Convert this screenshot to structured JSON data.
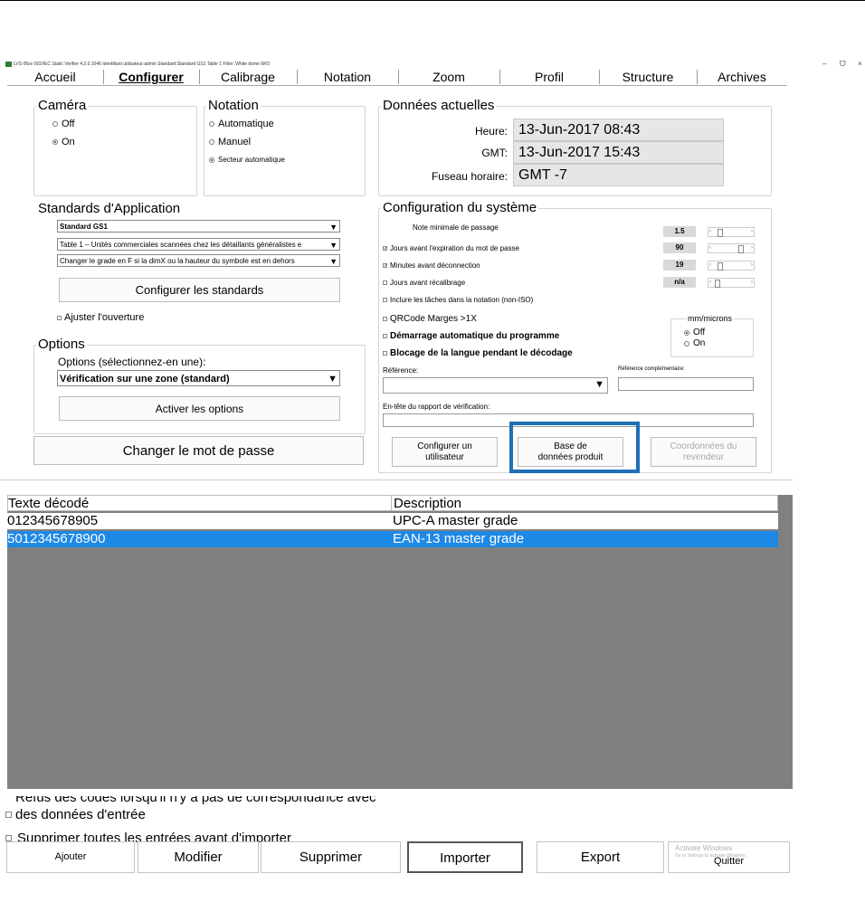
{
  "titlebar": {
    "text": "LVS-95xx ISO/IEC Static Verifier 4.2.0.1046   Identifiant utilisateur:admin   Standard:Standard GS1 Table 1   Filtre: White dome W/O",
    "minimize": "–",
    "maximize": "ᗜ",
    "close": "×"
  },
  "tabs": [
    "Accueil",
    "Configurer",
    "Calibrage",
    "Notation",
    "Zoom",
    "Profil",
    "Structure",
    "Archives"
  ],
  "camera": {
    "title": "Caméra",
    "options": [
      "Off",
      "On"
    ],
    "selected": "On"
  },
  "notation": {
    "title": "Notation",
    "options": [
      "Automatique",
      "Manuel",
      "Secteur automatique"
    ],
    "selected": "Secteur automatique"
  },
  "current_data": {
    "title": "Données actuelles",
    "heure_label": "Heure:",
    "heure_value": "13-Jun-2017 08:43",
    "gmt_label": "GMT:",
    "gmt_value": "13-Jun-2017 15:43",
    "tz_label": "Fuseau horaire:",
    "tz_value": "GMT -7"
  },
  "standards": {
    "title": "Standards d'Application",
    "dropdown1": "Standard GS1",
    "dropdown2": "Table 1 – Unités commerciales scannées chez les détaillants généralistes e",
    "dropdown3": "Changer le grade en F si la dimX ou la hauteur du symbole est en dehors",
    "configure_button": "Configurer les standards",
    "aperture_checkbox": "Ajuster l'ouverture"
  },
  "options": {
    "title": "Options",
    "label": "Options (sélectionnez-en une):",
    "dropdown": "Vérification sur une zone (standard)",
    "activate_button": "Activer les options"
  },
  "change_password_button": "Changer le mot de passe",
  "sysconfig": {
    "title": "Configuration du système",
    "min_grade_label": "Note minimale de passage",
    "min_grade_value": "1.5",
    "min_grade_level": 0.1,
    "pwd_expiry_label": "Jours avant l'expiration du mot de passe",
    "pwd_expiry_checked": true,
    "pwd_expiry_value": "90",
    "pwd_expiry_level": 0.75,
    "logout_label": "Minutes avant déconnection",
    "logout_checked": true,
    "logout_value": "19",
    "logout_level": 0.1,
    "recal_label": "Jours avant récalibrage",
    "recal_checked": false,
    "recal_value": "n/a",
    "recal_level": 0.0,
    "include_spots_label": "Inclure les tâches dans la notation (non-ISO)",
    "qrcode_label": "QRCode Marges >1X",
    "autostart_label": "Démarrage automatique du programme",
    "lang_lock_label": "Blocage de la langue pendant le décodage",
    "units_title": "mm/microns",
    "units_options": [
      "Off",
      "On"
    ],
    "units_selected": "Off",
    "reference_label": "Référence:",
    "reference_complement_label": "Référence complémentaire:",
    "report_header_label": "En-tête du rapport de vérification:",
    "configure_user_button": "Configurer un utilisateur",
    "product_db_button": "Base de données produit",
    "reseller_button": "Coordonnées du revendeur"
  },
  "table": {
    "columns": [
      "Texte décodé",
      "Description"
    ],
    "rows": [
      {
        "text": "012345678905",
        "description": "UPC-A master grade",
        "selected": false
      },
      {
        "text": "5012345678900",
        "description": "EAN-13 master grade",
        "selected": true
      }
    ]
  },
  "bottom": {
    "reject_checkbox_line1": "Refus des codes lorsqu'il n'y a pas de correspondance avec",
    "reject_checkbox_line2": "des données d'entrée",
    "delete_checkbox": "Supprimer toutes les entrées avant d'importer",
    "buttons": [
      "Ajouter",
      "Modifier",
      "Supprimer",
      "Importer",
      "Export",
      "Quitter"
    ],
    "watermark_line1": "Activate Windows",
    "watermark_line2": "Go to Settings to activate Windows."
  },
  "colors": {
    "highlight_box": "#1f6fb8",
    "selected_row": "#1e88e5",
    "table_bg": "#808080",
    "field_bg": "#e6e6e6"
  }
}
